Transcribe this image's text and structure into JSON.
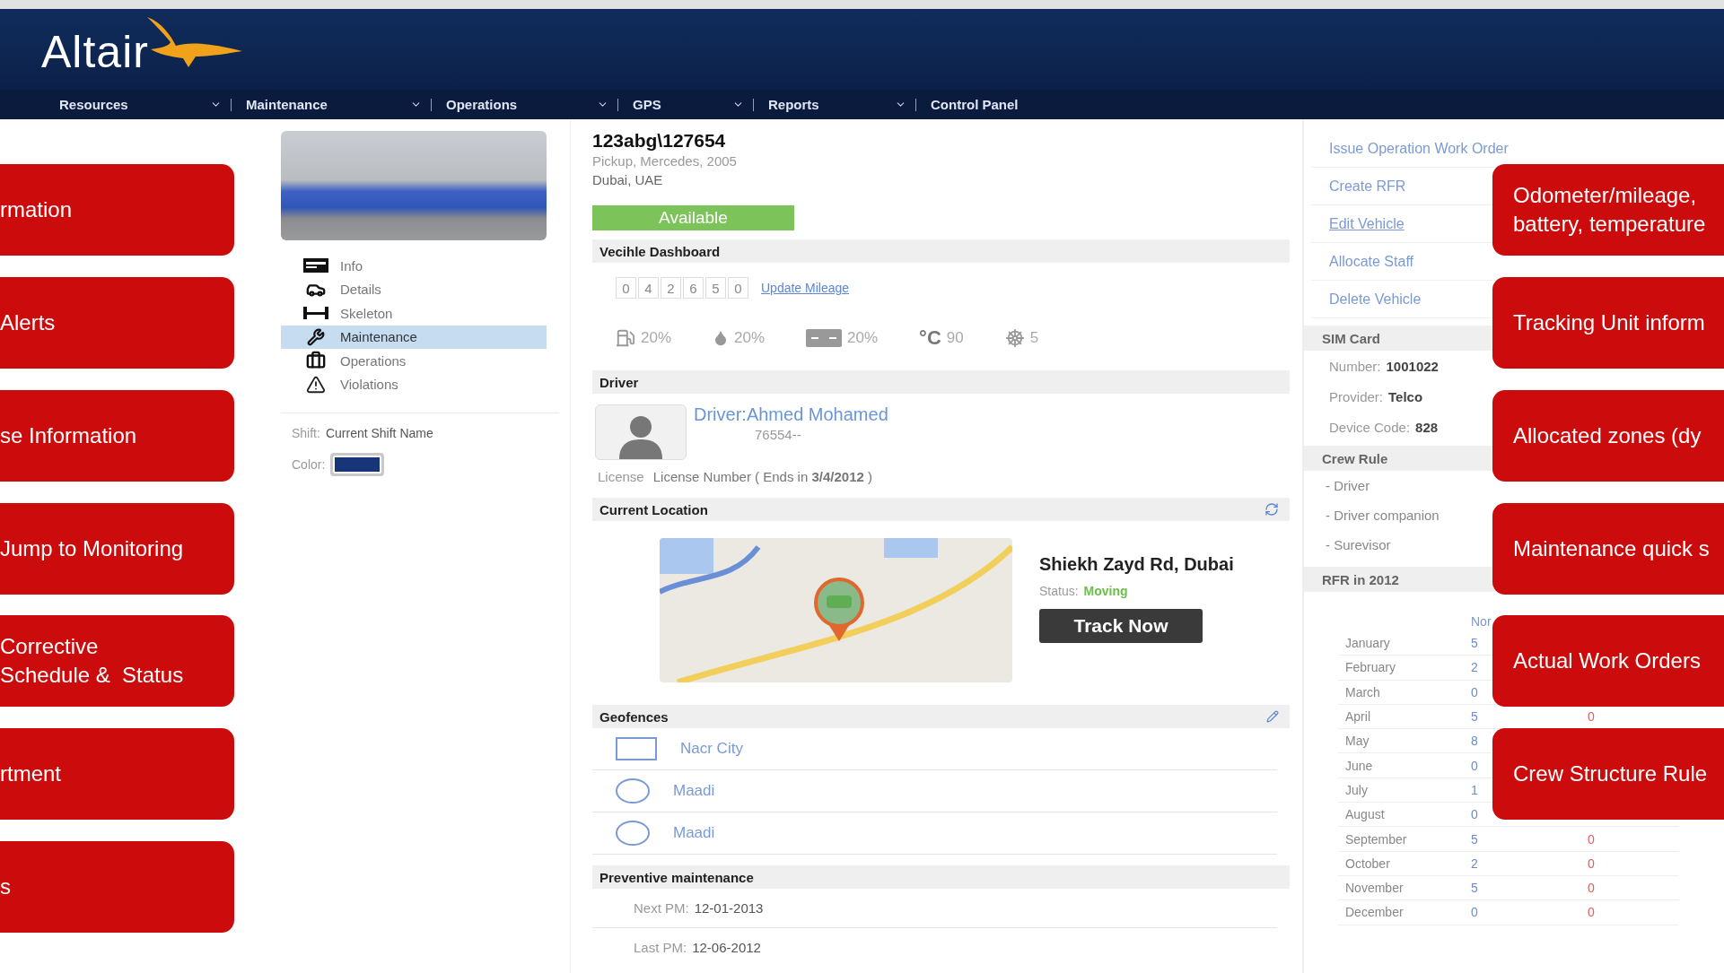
{
  "header": {
    "logo": "Altair"
  },
  "nav": [
    {
      "label": "Resources"
    },
    {
      "label": "Maintenance"
    },
    {
      "label": "Operations"
    },
    {
      "label": "GPS"
    },
    {
      "label": "Reports"
    },
    {
      "label": "Control Panel"
    }
  ],
  "vehicle_menu": [
    {
      "label": "Info",
      "selected": false
    },
    {
      "label": "Details",
      "selected": false
    },
    {
      "label": "Skeleton",
      "selected": false
    },
    {
      "label": "Maintenance",
      "selected": true
    },
    {
      "label": "Operations",
      "selected": false
    },
    {
      "label": "Violations",
      "selected": false
    }
  ],
  "shift": {
    "label": "Shift:",
    "value": "Current Shift Name",
    "swatch_label": "Color:",
    "color": "#17367a"
  },
  "vehicle": {
    "title": "123abg\\127654",
    "subtitle": "Pickup, Mercedes, 2005",
    "location": "Dubai, UAE",
    "status": "Available"
  },
  "dashboard": {
    "title": "Vecihle Dashboard",
    "odometer": [
      "0",
      "4",
      "2",
      "6",
      "5",
      "0"
    ],
    "update_link": "Update Mileage",
    "readings": [
      {
        "value": "20%"
      },
      {
        "value": "20%"
      },
      {
        "value": "20%"
      },
      {
        "unit": "°C",
        "value": "90"
      },
      {
        "value": "5"
      }
    ]
  },
  "driver": {
    "title": "Driver",
    "name": "Driver:Ahmed Mohamed",
    "code": "76554--",
    "license_label": "License",
    "license_text": "License Number  ( Ends in **3/4/2012** )"
  },
  "current_location": {
    "title": "Current Location",
    "address": "Shiekh Zayd Rd, Dubai",
    "status_label": "Status:",
    "status": "Moving",
    "button": "Track Now"
  },
  "geofences": {
    "title": "Geofences",
    "items": [
      {
        "kind": "rectangle",
        "name": "Nacr City"
      },
      {
        "kind": "circle",
        "name": "Maadi"
      },
      {
        "kind": "circle",
        "name": "Maadi"
      }
    ]
  },
  "preventive": {
    "title": "Preventive maintenance",
    "rows": [
      {
        "label": "Next PM:",
        "value": "12-01-2013"
      },
      {
        "label": "Last PM:",
        "value": "12-06-2012"
      }
    ]
  },
  "actions": [
    "Issue Operation Work Order",
    "Create RFR",
    "Edit Vehicle",
    "Allocate Staff",
    "Delete Vehicle"
  ],
  "sim_card": {
    "title": "SIM Card",
    "rows": [
      {
        "label": "Number:",
        "value": "1001022"
      },
      {
        "label": "Provider:",
        "value": "Telco"
      },
      {
        "label": "Device Code:",
        "value": "828"
      }
    ]
  },
  "crew_rule": {
    "title": "Crew Rule",
    "items": [
      "- Driver",
      "- Driver companion",
      "- Surevisor"
    ]
  },
  "rfr": {
    "title": "RFR in 2012",
    "column_2": "Nor",
    "rows": [
      {
        "month": "January",
        "value": "5"
      },
      {
        "month": "February",
        "value": "2"
      },
      {
        "month": "March",
        "value": "0"
      },
      {
        "month": "April",
        "value": "5",
        "column_3": "0"
      },
      {
        "month": "May",
        "value": "8"
      },
      {
        "month": "June",
        "value": "0"
      },
      {
        "month": "July",
        "value": "1"
      },
      {
        "month": "August",
        "value": "0"
      },
      {
        "month": "September",
        "value": "5",
        "column_3": "0"
      },
      {
        "month": "October",
        "value": "2",
        "column_3": "0"
      },
      {
        "month": "November",
        "value": "5",
        "column_3": "0"
      },
      {
        "month": "December",
        "value": "0",
        "column_3": "0"
      }
    ]
  },
  "callouts_left": [
    "rmation",
    "Alerts",
    "se Information",
    "Jump to Monitoring",
    "Corrective\nSchedule &  Status",
    "rtment",
    "s"
  ],
  "callouts_right": [
    "Odometer/mileage,\nbattery, temperature",
    "Tracking Unit inform",
    "Allocated zones (dy",
    "Maintenance quick s",
    "Actual Work Orders",
    "Crew Structure Rule"
  ]
}
